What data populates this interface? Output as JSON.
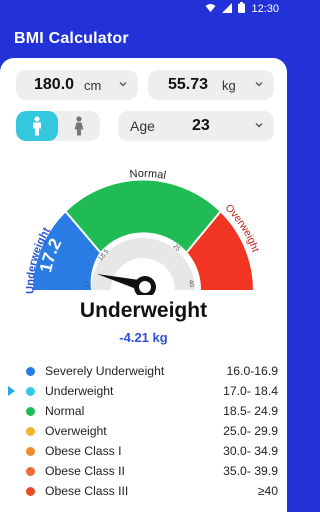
{
  "status": {
    "time": "12:30"
  },
  "app": {
    "title": "BMI Calculator"
  },
  "inputs": {
    "height": {
      "value": "180.0",
      "unit": "cm"
    },
    "weight": {
      "value": "55.73",
      "unit": "kg"
    },
    "age": {
      "label": "Age",
      "value": "23"
    }
  },
  "gender": {
    "selected": "male"
  },
  "gauge": {
    "bmi_value": "17.2",
    "segments": [
      {
        "label": "Underweight",
        "color": "#2a7be4"
      },
      {
        "label": "Normal",
        "color": "#21bb55"
      },
      {
        "label": "Overweight",
        "color": "#f23523"
      }
    ],
    "ticks": [
      "17",
      "18.5",
      "25",
      "40"
    ]
  },
  "result": {
    "category": "Underweight",
    "difference": "-4.21 kg"
  },
  "legend": [
    {
      "name": "Severely Underweight",
      "range": "16.0-16.9",
      "color": "#2a7be4",
      "selected": false
    },
    {
      "name": "Underweight",
      "range": "17.0- 18.4",
      "color": "#33c8e8",
      "selected": true
    },
    {
      "name": "Normal",
      "range": "18.5- 24.9",
      "color": "#21bb55",
      "selected": false
    },
    {
      "name": "Overweight",
      "range": "25.0- 29.9",
      "color": "#f6b22a",
      "selected": false
    },
    {
      "name": "Obese Class I",
      "range": "30.0- 34.9",
      "color": "#f28a32",
      "selected": false
    },
    {
      "name": "Obese Class II",
      "range": "35.0- 39.9",
      "color": "#f06a33",
      "selected": false
    },
    {
      "name": "Obese Class III",
      "range": "≥40",
      "color": "#ea4b24",
      "selected": false
    }
  ]
}
